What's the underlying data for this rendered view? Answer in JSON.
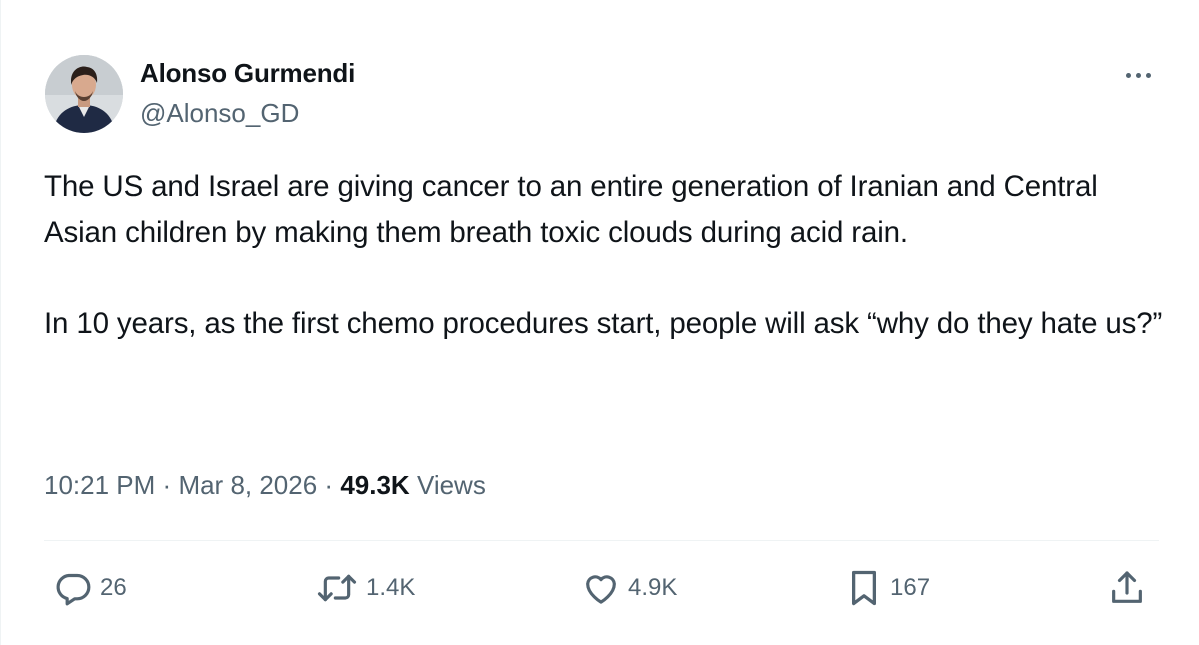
{
  "tweet": {
    "display_name": "Alonso Gurmendi",
    "handle": "@Alonso_GD",
    "paragraph_1": "The US and Israel are giving cancer to an entire generation of Iranian and Central Asian children by making them breath toxic clouds during acid rain.",
    "paragraph_2": "In 10 years, as the first chemo procedures start, people will ask “why do they hate us?”",
    "time": "10:21 PM",
    "separator": "·",
    "date": "Mar 8, 2026",
    "views_count": "49.3K",
    "views_label": "Views"
  },
  "actions": {
    "replies": "26",
    "reposts": "1.4K",
    "likes": "4.9K",
    "bookmarks": "167"
  },
  "icons": {
    "more": "more-horizontal-icon",
    "reply": "reply-icon",
    "repost": "repost-icon",
    "like": "heart-icon",
    "bookmark": "bookmark-icon",
    "share": "share-icon"
  },
  "colors": {
    "text": "#0f1419",
    "secondary": "#536471",
    "divider": "#eff3f4"
  }
}
